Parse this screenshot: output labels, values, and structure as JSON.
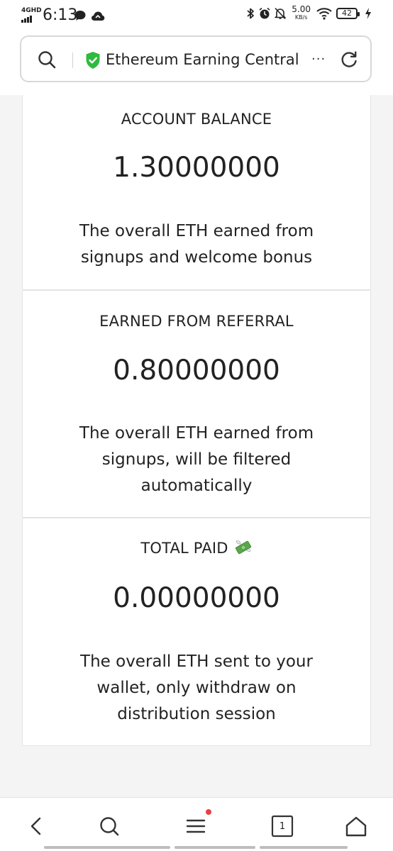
{
  "status_bar": {
    "network": "4GHD",
    "time": "6:13",
    "speed_value": "5.00",
    "speed_unit": "KB/s",
    "battery": "42",
    "icons": [
      "chat-bubble-icon",
      "cloud-app-icon",
      "bluetooth-icon",
      "alarm-icon",
      "mute-icon",
      "wifi-icon",
      "charging-icon"
    ]
  },
  "address_bar": {
    "title": "Ethereum Earning Central",
    "more": "···",
    "secure_color": "#2dbb3f"
  },
  "cards": [
    {
      "heading": "ACCOUNT BALANCE",
      "value": "1.30000000",
      "description": "The overall ETH earned from signups and welcome bonus"
    },
    {
      "heading": "EARNED FROM REFERRAL",
      "value": "0.80000000",
      "description": "The overall ETH earned from signups, will be filtered automatically"
    },
    {
      "heading": "TOTAL PAID",
      "heading_icon": "money-with-wings-icon",
      "value": "0.00000000",
      "description": "The overall ETH sent to your wallet, only withdraw on distribution session"
    }
  ],
  "bottom_nav": {
    "tab_count": "1",
    "badge_color": "#e84040"
  }
}
